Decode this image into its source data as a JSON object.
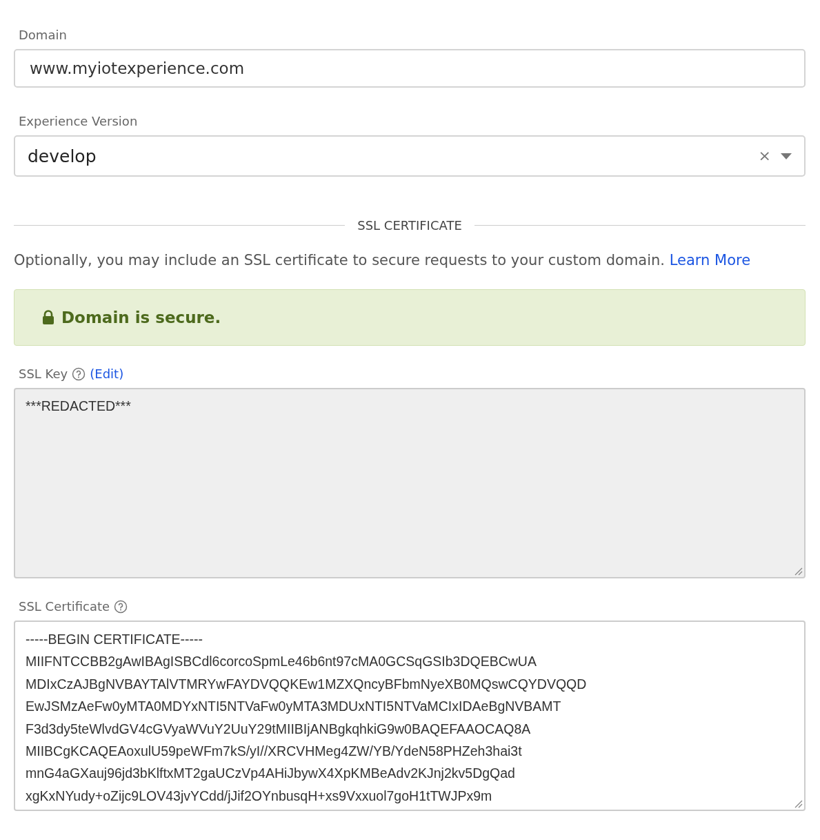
{
  "domain": {
    "label": "Domain",
    "value": "www.myiotexperience.com"
  },
  "experience_version": {
    "label": "Experience Version",
    "value": "develop",
    "clear": "×"
  },
  "ssl_section": {
    "heading": "SSL CERTIFICATE",
    "description": "Optionally, you may include an SSL certificate to secure requests to your custom domain.",
    "link": "Learn More"
  },
  "alert": {
    "text": "Domain is secure."
  },
  "ssl_key": {
    "label": "SSL Key",
    "edit_link": "(Edit)",
    "value": "***REDACTED***",
    "disabled": true
  },
  "ssl_certificate": {
    "label": "SSL Certificate",
    "disabled": false,
    "lines": [
      "-----BEGIN CERTIFICATE-----",
      "MIIFNTCCBB2gAwIBAgISBCdl6corcoSpmLe46b6nt97cMA0GCSqGSIb3DQEBCwUA",
      "MDIxCzAJBgNVBAYTAlVTMRYwFAYDVQQKEw1MZXQncyBFbmNyeXB0MQswCQYDVQQD",
      "EwJSMzAeFw0yMTA0MDYxNTI5NTVaFw0yMTA3MDUxNTI5NTVaMCIxIDAeBgNVBAMT",
      "F3d3dy5teWlvdGV4cGVyaWVuY2UuY29tMIIBIjANBgkqhkiG9w0BAQEFAAOCAQ8A",
      "MIIBCgKCAQEAoxulU59peWFm7kS/yI//XRCVHMeg4ZW/YB/YdeN58PHZeh3hai3t",
      "mnG4aGXauj96jd3bKlftxMT2gaUCzVp4AHiJbywX4XpKMBeAdv2KJnj2kv5DgQad",
      "xgKxNYudy+oZijc9LOV43jvYCdd/jJif2OYnbusqH+xs9Vxxuol7goH1tTWJPx9m"
    ]
  }
}
